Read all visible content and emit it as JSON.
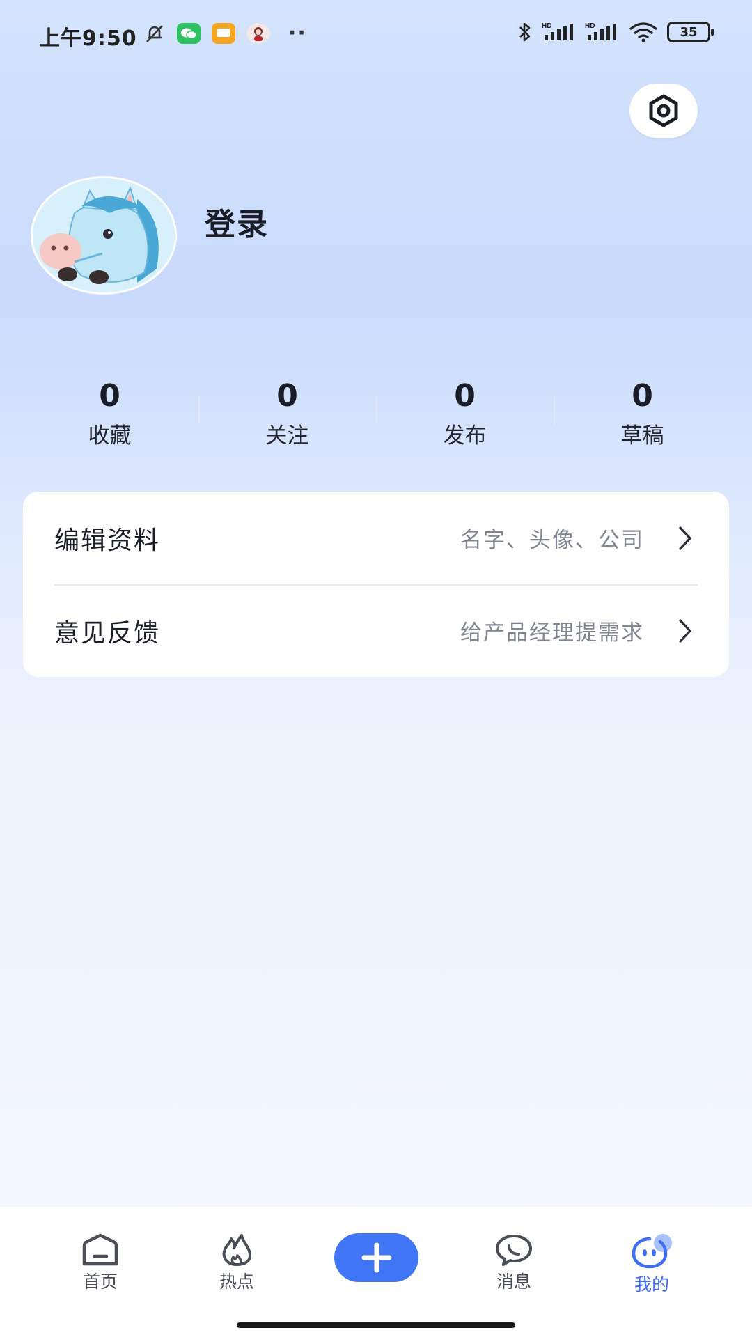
{
  "status_bar": {
    "time": "上午9:50",
    "battery": "35"
  },
  "profile": {
    "login_label": "登录"
  },
  "stats": [
    {
      "count": "0",
      "label": "收藏"
    },
    {
      "count": "0",
      "label": "关注"
    },
    {
      "count": "0",
      "label": "发布"
    },
    {
      "count": "0",
      "label": "草稿"
    }
  ],
  "menu": [
    {
      "title": "编辑资料",
      "hint": "名字、头像、公司"
    },
    {
      "title": "意见反馈",
      "hint": "给产品经理提需求"
    }
  ],
  "tab_bar": {
    "home": "首页",
    "hot": "热点",
    "messages": "消息",
    "mine": "我的",
    "accent_color": "#3e6ef4"
  }
}
